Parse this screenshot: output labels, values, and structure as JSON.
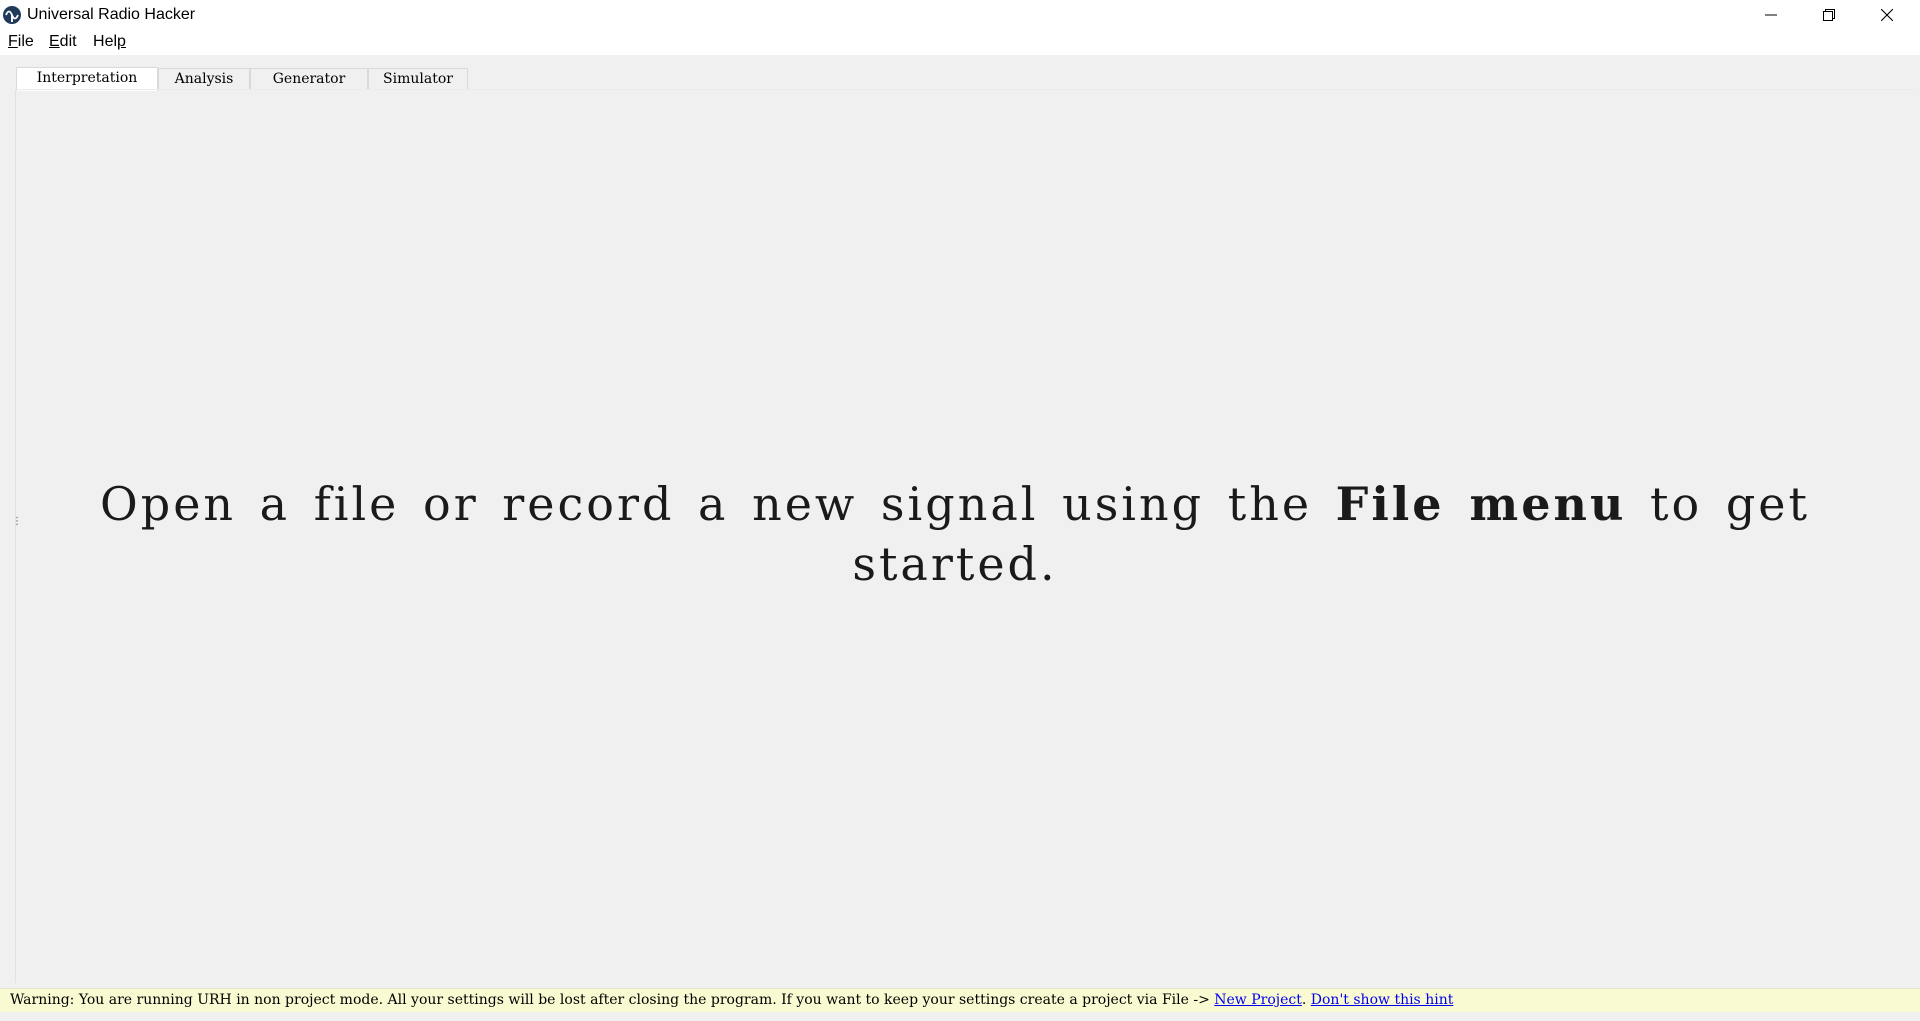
{
  "window": {
    "title": "Universal Radio Hacker",
    "icon": "urh-logo-icon",
    "controls": [
      "minimize-icon",
      "restore-icon",
      "close-icon"
    ]
  },
  "menu": {
    "items": [
      {
        "label_underlined": "F",
        "label_rest": "ile"
      },
      {
        "label_underlined": "E",
        "label_rest": "dit"
      },
      {
        "label_underlined": "H",
        "label_rest": "elp"
      }
    ]
  },
  "tabs": {
    "items": [
      {
        "label": "Interpretation",
        "active": true
      },
      {
        "label": "Analysis",
        "active": false
      },
      {
        "label": "Generator",
        "active": false
      },
      {
        "label": "Simulator",
        "active": false
      }
    ]
  },
  "main": {
    "hint_before": "Open a file or record a new signal using the ",
    "hint_bold": "File menu",
    "hint_after": " to get started."
  },
  "warning": {
    "text": "Warning: You are running URH in non project mode. All your settings will be lost after closing the program. If you want to keep your settings create a project via File -> ",
    "link_new_project": "New Project",
    "separator": ". ",
    "link_dont_show": "Don't show this hint",
    "background": "#fafad2",
    "link_color": "#0000ee"
  }
}
